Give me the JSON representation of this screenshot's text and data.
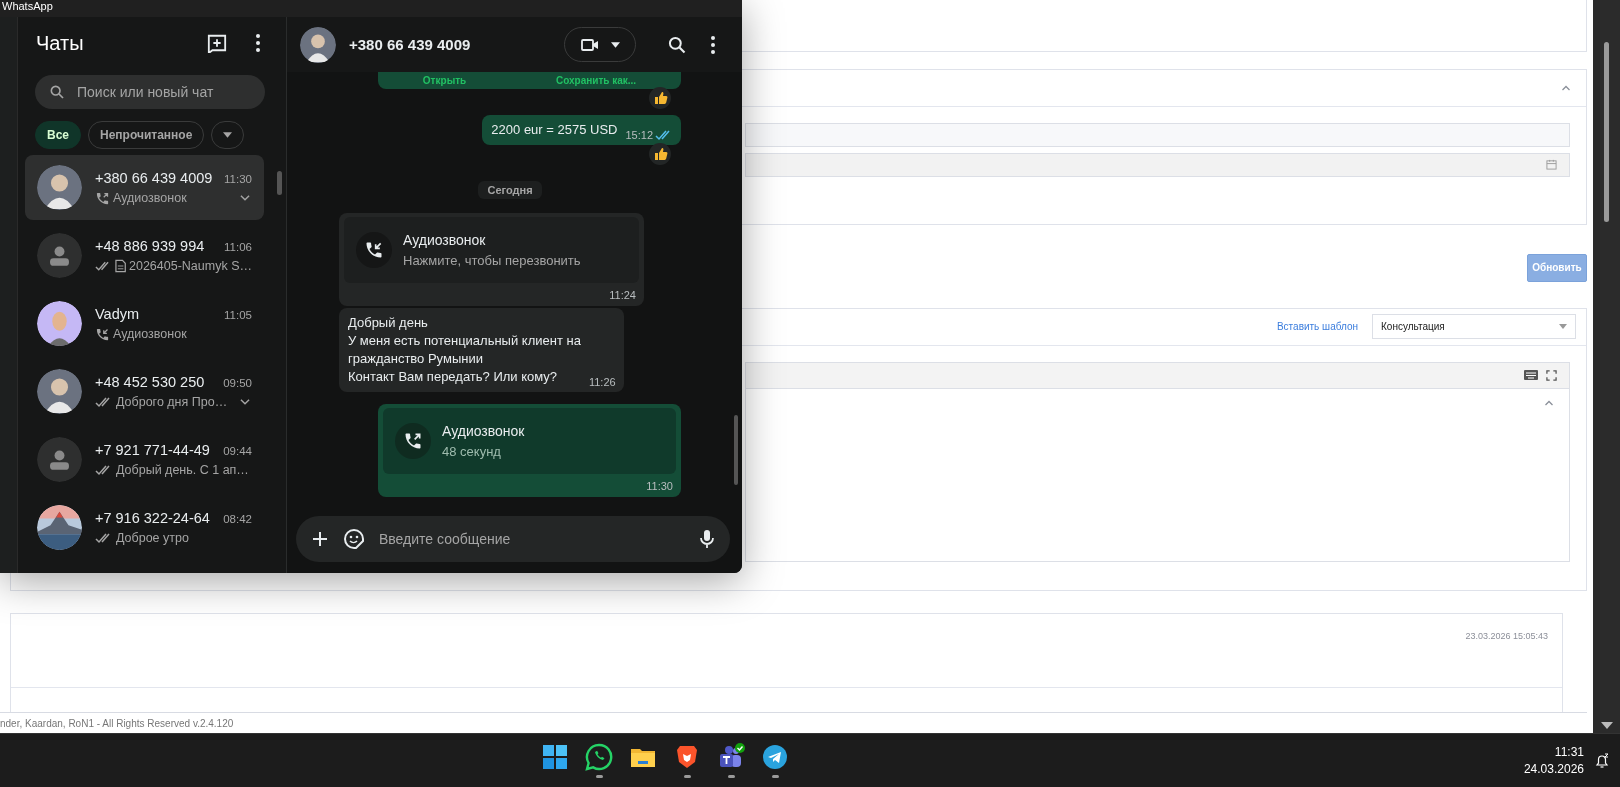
{
  "web_page": {
    "insert_template_link": "Вставить шаблон",
    "template_select": {
      "value": "Консультация"
    },
    "update_button": "Обновить",
    "entry_timestamp": "23.03.2026 15:05:43",
    "footer": "nder, Kaardan, RoN1 - All Rights Reserved v.2.4.120"
  },
  "whatsapp": {
    "window": {
      "title": "WhatsApp"
    },
    "chat_list": {
      "title": "Чаты",
      "search": {
        "placeholder": "Поиск или новый чат"
      },
      "filters": [
        {
          "label": "Все",
          "selected": true
        },
        {
          "label": "Непрочитанное",
          "selected": false
        }
      ],
      "chats": [
        {
          "name": "+380 66 439 4009",
          "time": "11:30",
          "preview": "Аудиозвонок",
          "status": {
            "kind": "call_out"
          },
          "avatar": {
            "kind": "person"
          },
          "chevron": true,
          "selected": true
        },
        {
          "name": "+48 886 939 994",
          "time": "11:06",
          "preview": "2026405-Naumyk S…",
          "status": {
            "kind": "read_doc"
          },
          "avatar": {
            "kind": "default"
          },
          "chevron": false,
          "selected": false
        },
        {
          "name": "Vadym",
          "time": "11:05",
          "preview": "Аудиозвонок",
          "status": {
            "kind": "call_in"
          },
          "avatar": {
            "kind": "figure"
          },
          "chevron": false,
          "selected": false
        },
        {
          "name": "+48 452 530 250",
          "time": "09:50",
          "preview": "Доброго дня Про…",
          "status": {
            "kind": "read"
          },
          "avatar": {
            "kind": "person"
          },
          "chevron": true,
          "selected": false
        },
        {
          "name": "+7 921 771-44-49",
          "time": "09:44",
          "preview": "Добрый день. С 1 ап…",
          "status": {
            "kind": "read"
          },
          "avatar": {
            "kind": "default"
          },
          "chevron": false,
          "selected": false
        },
        {
          "name": "+7 916 322-24-64",
          "time": "08:42",
          "preview": "Доброе утро",
          "status": {
            "kind": "read"
          },
          "avatar": {
            "kind": "landscape"
          },
          "chevron": false,
          "selected": false
        }
      ]
    },
    "chat": {
      "contact": "+380 66 439 4009",
      "messages": [
        {
          "kind": "file_actions",
          "outgoing": true,
          "actions": [
            "Открыть",
            "Сохранить как..."
          ]
        },
        {
          "kind": "reaction"
        },
        {
          "kind": "text",
          "outgoing": true,
          "text": "2200 eur = 2575 USD",
          "time": "15:12",
          "read": true
        },
        {
          "kind": "reaction"
        },
        {
          "kind": "date",
          "text": "Сегодня"
        },
        {
          "kind": "call",
          "outgoing": false,
          "title": "Аудиозвонок",
          "subtitle": "Нажмите, чтобы перезвонить",
          "time": "11:24"
        },
        {
          "kind": "text",
          "outgoing": false,
          "text": "Добрый день\nУ меня есть потенциальный клиент на\nгражданство Румынии\nКонтакт Вам передать? Или кому?",
          "time": "11:26",
          "read": false
        },
        {
          "kind": "call",
          "outgoing": true,
          "title": "Аудиозвонок",
          "subtitle": "48 секунд",
          "time": "11:30"
        }
      ],
      "composer": {
        "placeholder": "Введите сообщение"
      }
    }
  },
  "taskbar": {
    "apps": [
      {
        "kind": "start",
        "running": false
      },
      {
        "kind": "whatsapp",
        "running": true
      },
      {
        "kind": "files",
        "running": false
      },
      {
        "kind": "brave",
        "running": true
      },
      {
        "kind": "teams",
        "running": true
      },
      {
        "kind": "telegram",
        "running": true
      }
    ],
    "time": "11:31",
    "date": "24.03.2026"
  }
}
